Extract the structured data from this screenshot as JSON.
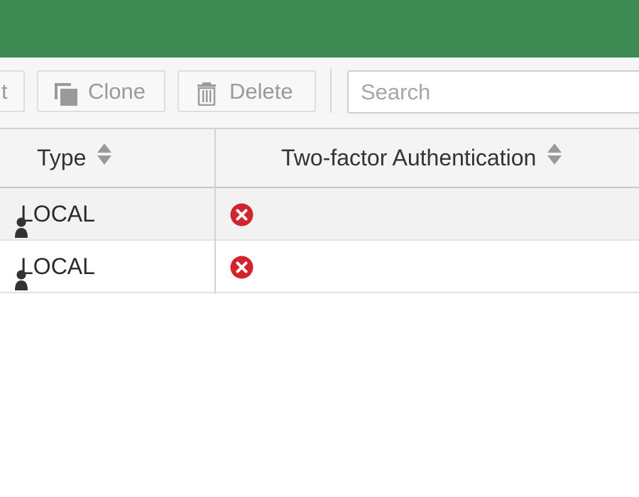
{
  "toolbar": {
    "edit_fragment": "t",
    "clone_label": "Clone",
    "delete_label": "Delete",
    "search_placeholder": "Search"
  },
  "table": {
    "columns": [
      {
        "label": "Type"
      },
      {
        "label": "Two-factor Authentication"
      }
    ],
    "rows": [
      {
        "type": "LOCAL",
        "two_factor": "disabled"
      },
      {
        "type": "LOCAL",
        "two_factor": "disabled"
      }
    ]
  },
  "colors": {
    "header_bar": "#3d8b52",
    "status_disabled": "#d1242f"
  },
  "icons": {
    "clone": "clone-icon",
    "delete": "trash-icon",
    "sort": "sort-icon",
    "user": "user-icon",
    "disabled": "x-circle-icon"
  }
}
